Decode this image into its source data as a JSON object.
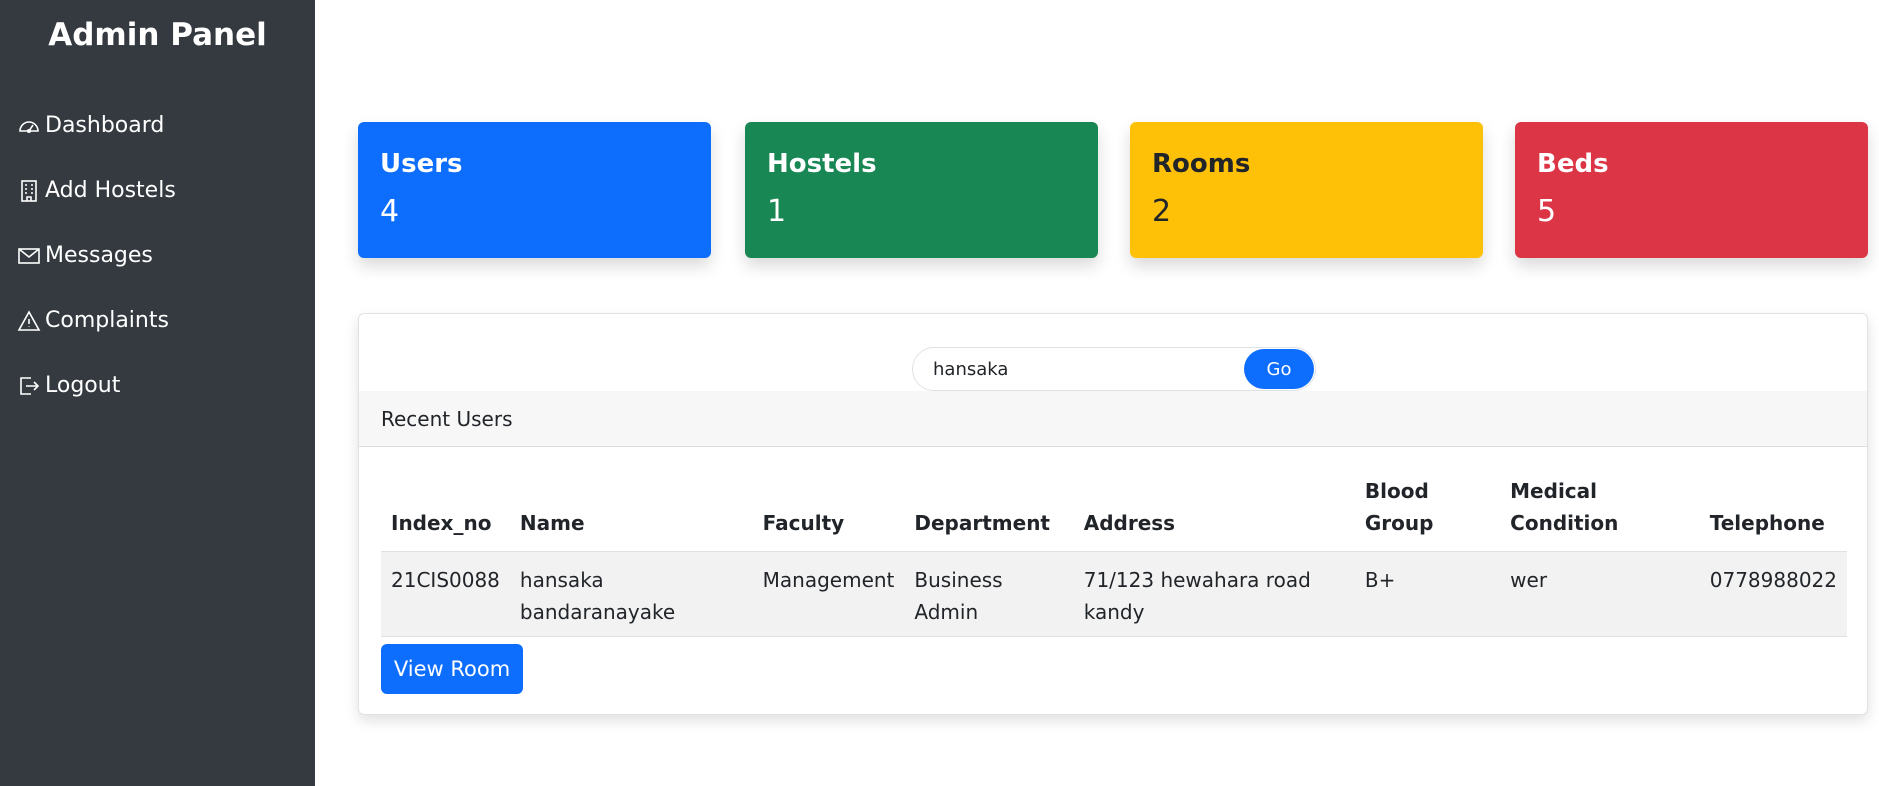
{
  "sidebar": {
    "title": "Admin Panel",
    "items": [
      {
        "label": "Dashboard",
        "icon": "speedometer-icon"
      },
      {
        "label": "Add Hostels",
        "icon": "building-icon"
      },
      {
        "label": "Messages",
        "icon": "envelope-icon"
      },
      {
        "label": "Complaints",
        "icon": "warning-icon"
      },
      {
        "label": "Logout",
        "icon": "logout-icon"
      }
    ]
  },
  "stats": {
    "users": {
      "label": "Users",
      "value": "4",
      "color": "#0d6efd"
    },
    "hostels": {
      "label": "Hostels",
      "value": "1",
      "color": "#198754"
    },
    "rooms": {
      "label": "Rooms",
      "value": "2",
      "color": "#ffc107"
    },
    "beds": {
      "label": "Beds",
      "value": "5",
      "color": "#dc3545"
    }
  },
  "search": {
    "value": "hansaka",
    "button_label": "Go"
  },
  "recent_users": {
    "title": "Recent Users",
    "columns": [
      "Index_no",
      "Name",
      "Faculty",
      "Department",
      "Address",
      "Blood Group",
      "Medical Condition",
      "Telephone"
    ],
    "rows": [
      {
        "index_no": "21CIS0088",
        "name": "hansaka bandaranayake",
        "faculty": "Management",
        "department": "Business Admin",
        "address": "71/123 hewahara road kandy",
        "blood_group": "B+",
        "medical_condition": "wer",
        "telephone": "0778988022"
      }
    ]
  },
  "view_room_label": "View Room"
}
